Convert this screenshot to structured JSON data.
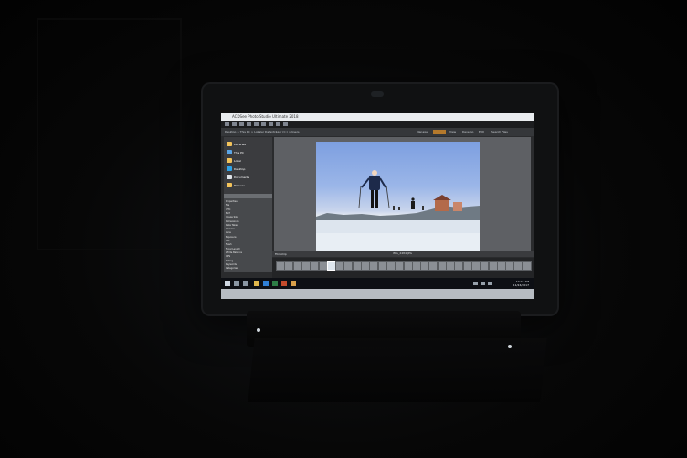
{
  "window": {
    "title": "ACDSee Photo Studio Ultimate 2018"
  },
  "toolbar": {
    "path": "Desktop > This PC > Lokaler Datenträger (C:) > Users",
    "modes": [
      "Manage",
      "Photos",
      "View",
      "Develop",
      "Edit",
      "365"
    ],
    "right_items": [
      "Quickview",
      "Catalog",
      "Search Files"
    ]
  },
  "sidebar": {
    "folders": [
      {
        "label": "Libraries",
        "color": "#f3c35a"
      },
      {
        "label": "This PC",
        "color": "#5aa5e6"
      },
      {
        "label": "Lokal",
        "color": "#f3c35a"
      },
      {
        "label": "Desktop",
        "color": "#2fa3e8"
      },
      {
        "label": "Documents",
        "color": "#dfe3e8"
      },
      {
        "label": "Pictures",
        "color": "#f3c35a"
      }
    ],
    "panel_rows": [
      "Properties",
      "File",
      "IPTC",
      "Exif",
      "Image Size",
      "Dimensions",
      "Date Taken",
      "Camera",
      "Lens",
      "Exposure",
      "ISO",
      "Flash",
      "Focal Length",
      "White Balance",
      "GPS",
      "Rating",
      "Keywords",
      "Categories"
    ]
  },
  "viewer": {
    "filename": "IMG_2484.JPG"
  },
  "filmstrip": {
    "header": "Filmstrip",
    "thumb_count": 30,
    "selected_index": 6
  },
  "taskbar": {
    "time": "10:23 AM",
    "date": "11/24/2017"
  }
}
